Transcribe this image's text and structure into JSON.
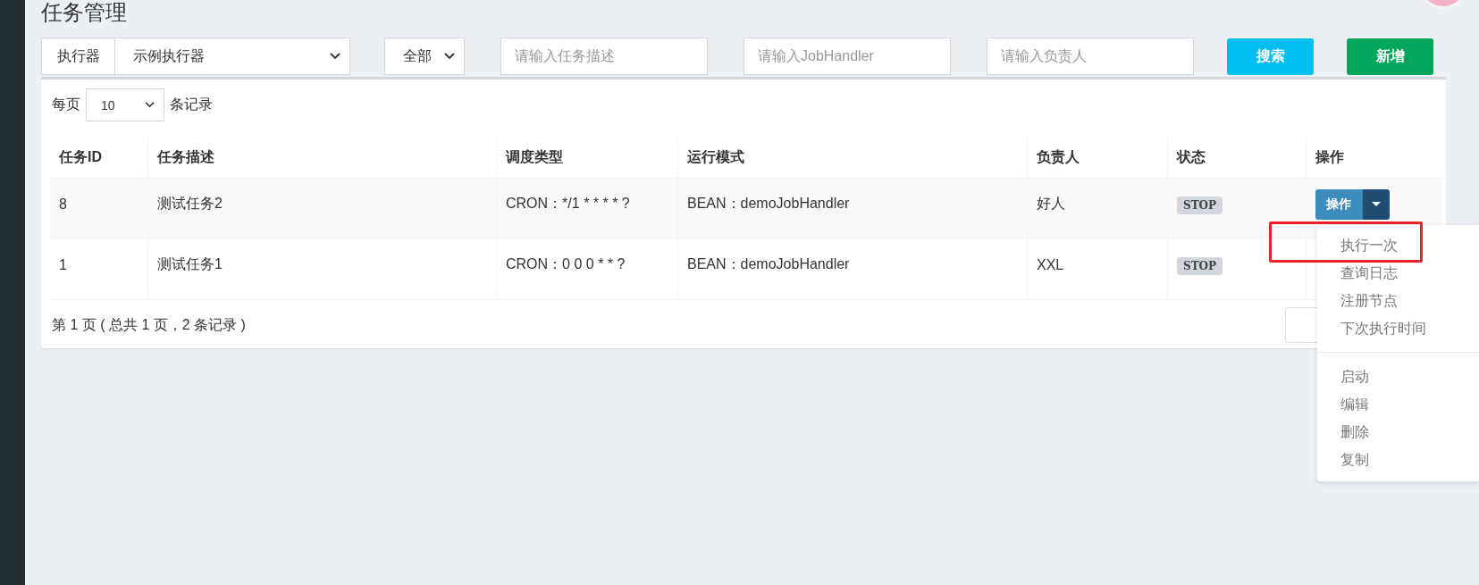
{
  "page_title": "任务管理",
  "filters": {
    "executor_label": "执行器",
    "executor_value": "示例执行器",
    "status_value": "全部",
    "desc_placeholder": "请输入任务描述",
    "handler_placeholder": "请输入JobHandler",
    "author_placeholder": "请输入负责人",
    "search_button": "搜索",
    "add_button": "新增"
  },
  "page_size": {
    "prefix": "每页",
    "value": "10",
    "suffix": "条记录"
  },
  "table": {
    "columns": [
      "任务ID",
      "任务描述",
      "调度类型",
      "运行模式",
      "负责人",
      "状态",
      "操作"
    ],
    "rows": [
      {
        "id": "8",
        "desc": "测试任务2",
        "schedule": "CRON：*/1 * * * * ?",
        "mode": "BEAN：demoJobHandler",
        "author": "好人",
        "status": "STOP",
        "action": "操作",
        "menu_open": true
      },
      {
        "id": "1",
        "desc": "测试任务1",
        "schedule": "CRON：0 0 0 * * ?",
        "mode": "BEAN：demoJobHandler",
        "author": "XXL",
        "status": "STOP",
        "menu_open": false
      }
    ]
  },
  "pagination": {
    "info": "第 1 页 ( 总共 1 页，2 条记录 )"
  },
  "action_menu": [
    [
      {
        "label": "执行一次",
        "annotated": true
      },
      {
        "label": "查询日志",
        "annotated": false
      },
      {
        "label": "注册节点",
        "annotated": false
      },
      {
        "label": "下次执行时间",
        "annotated": false
      }
    ],
    [
      {
        "label": "启动",
        "annotated": false
      },
      {
        "label": "编辑",
        "annotated": false
      },
      {
        "label": "删除",
        "annotated": false
      },
      {
        "label": "复制",
        "annotated": false
      }
    ]
  ]
}
